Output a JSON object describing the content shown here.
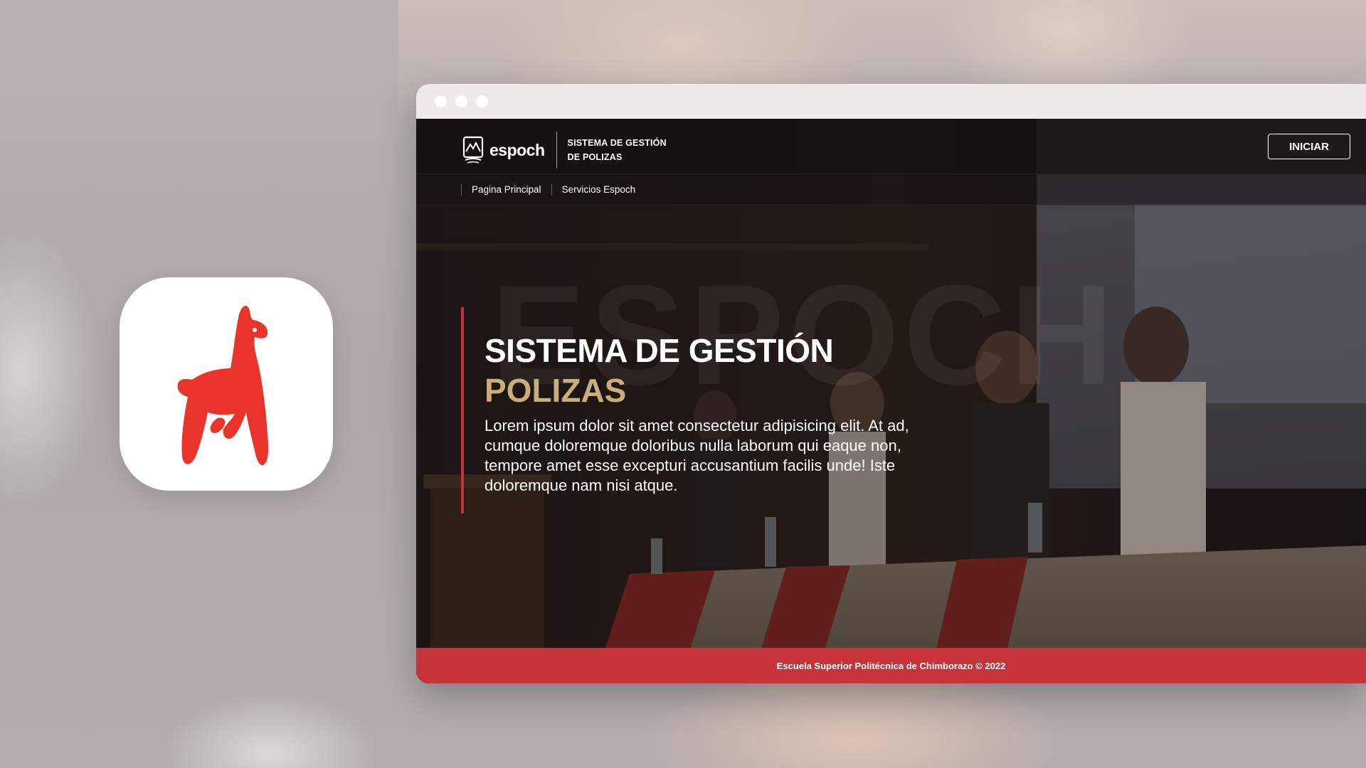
{
  "app_icon": {
    "icon": "llama-icon",
    "color": "#e8342a"
  },
  "browser": {
    "window_controls": [
      "close",
      "minimize",
      "maximize"
    ]
  },
  "header": {
    "brand_name": "espoch",
    "system_line1": "SISTEMA DE GESTIÓN",
    "system_line2": "DE POLIZAS",
    "start_button": "INICIAR"
  },
  "nav": {
    "items": [
      {
        "label": "Pagina Principal"
      },
      {
        "label": "Servicios Espoch"
      }
    ]
  },
  "hero": {
    "watermark": "ESPOCH",
    "title": "SISTEMA DE GESTIÓN",
    "subtitle": "POLIZAS",
    "text": "Lorem ipsum dolor sit amet consectetur adipisicing elit. At ad, cumque doloremque doloribus nulla laborum qui eaque non, tempore amet esse excepturi accusantium facilis unde! Iste doloremque nam nisi atque."
  },
  "footer": {
    "text": "Escuela Superior Politécnica de Chimborazo © 2022"
  },
  "colors": {
    "accent_red": "#c8333a",
    "gold": "#c8ae7c"
  }
}
